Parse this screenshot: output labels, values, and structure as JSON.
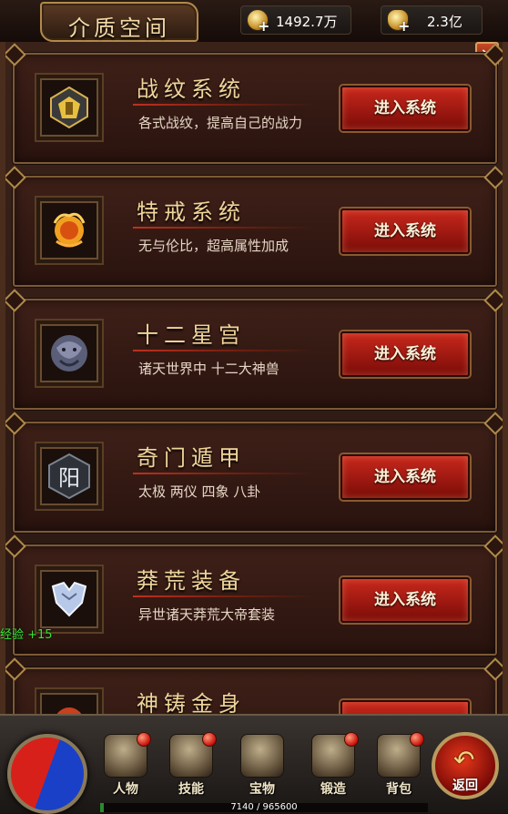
{
  "header": {
    "title": "介质空间",
    "currencies": [
      {
        "icon": "coin-icon",
        "value": "1492.7万"
      },
      {
        "icon": "ingot-icon",
        "value": "2.3亿"
      }
    ],
    "close_label": "×"
  },
  "cards": [
    {
      "icon": "pattern-emblem-icon",
      "title": "战纹系统",
      "desc": "各式战纹，提高自己的战力",
      "button": "进入系统"
    },
    {
      "icon": "fire-beast-icon",
      "title": "特戒系统",
      "desc": "无与伦比，超高属性加成",
      "button": "进入系统"
    },
    {
      "icon": "dragon-head-icon",
      "title": "十二星宫",
      "desc": "诸天世界中 十二大神兽",
      "button": "进入系统"
    },
    {
      "icon": "yang-rune-icon",
      "title": "奇门遁甲",
      "desc": "太极 两仪 四象 八卦",
      "button": "进入系统"
    },
    {
      "icon": "armor-icon",
      "title": "莽荒装备",
      "desc": "异世诸天莽荒大帝套装",
      "button": "进入系统"
    },
    {
      "icon": "golden-body-icon",
      "title": "神铸金身",
      "desc": "",
      "button": ""
    }
  ],
  "exp_popup": "经验 +15",
  "nav": [
    {
      "icon": "character-icon",
      "label": "人物"
    },
    {
      "icon": "skill-icon",
      "label": "技能"
    },
    {
      "icon": "treasure-icon",
      "label": "宝物"
    },
    {
      "icon": "forge-icon",
      "label": "锻造"
    },
    {
      "icon": "bag-icon",
      "label": "背包"
    }
  ],
  "return_label": "返回",
  "exp_bar": {
    "text": "7140 / 965600",
    "fraction": 0.0074
  },
  "colors": {
    "accent": "#c8281c",
    "title_gold": "#f0d49a"
  }
}
